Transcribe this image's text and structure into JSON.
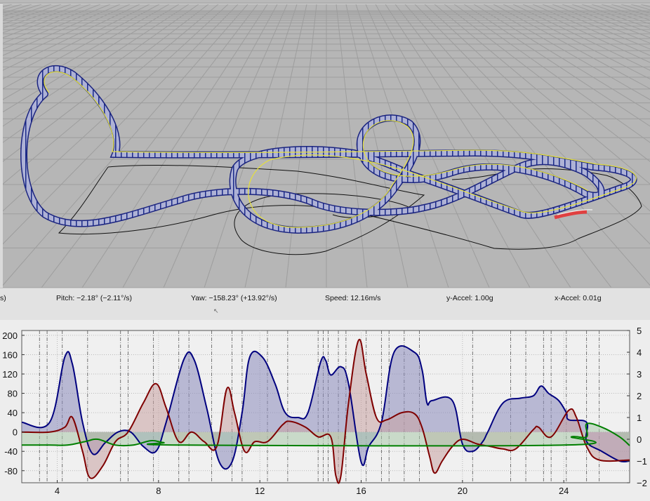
{
  "status": {
    "cut_label": "s)",
    "pitch": "Pitch: −2.18° (−2.11°/s)",
    "yaw": "Yaw: −158.23° (+13.92°/s)",
    "speed": "Speed: 12.16m/s",
    "y_accel": "y-Accel: 1.00g",
    "x_accel": "x-Accel: 0.01g"
  },
  "chart_data": {
    "type": "line",
    "x_ticks": [
      "4",
      "8",
      "12",
      "16",
      "20",
      "24"
    ],
    "x_tick_values": [
      4,
      8,
      12,
      16,
      20,
      24
    ],
    "xlim": [
      2.6,
      26.6
    ],
    "left_axis": {
      "ticks": [
        "200",
        "160",
        "120",
        "80",
        "40",
        "0",
        "-40",
        "-80"
      ],
      "tick_values": [
        200,
        160,
        120,
        80,
        40,
        0,
        -40,
        -80
      ],
      "ylim": [
        -105,
        210
      ]
    },
    "right_axis": {
      "ticks": [
        "5",
        "4",
        "3",
        "2",
        "1",
        "0",
        "−1",
        "−2"
      ],
      "tick_values": [
        5,
        4,
        3,
        2,
        1,
        0,
        -1,
        -2
      ],
      "ylim": [
        -2,
        5
      ]
    },
    "series": [
      {
        "color": "#00007f",
        "fill": "#8a8abc",
        "axis": "left",
        "points": [
          [
            2.6,
            20
          ],
          [
            3.7,
            20
          ],
          [
            4.3,
            155
          ],
          [
            4.6,
            140
          ],
          [
            5.0,
            20
          ],
          [
            5.4,
            -45
          ],
          [
            5.9,
            -22
          ],
          [
            6.4,
            0
          ],
          [
            6.9,
            0
          ],
          [
            7.4,
            -30
          ],
          [
            7.9,
            -40
          ],
          [
            8.3,
            20
          ],
          [
            9.0,
            150
          ],
          [
            9.4,
            150
          ],
          [
            9.9,
            50
          ],
          [
            10.4,
            -62
          ],
          [
            10.9,
            -62
          ],
          [
            11.3,
            40
          ],
          [
            11.6,
            155
          ],
          [
            12.1,
            155
          ],
          [
            12.6,
            100
          ],
          [
            13.0,
            40
          ],
          [
            13.5,
            30
          ],
          [
            13.9,
            40
          ],
          [
            14.4,
            145
          ],
          [
            14.6,
            148
          ],
          [
            14.8,
            118
          ],
          [
            15.2,
            135
          ],
          [
            15.5,
            100
          ],
          [
            16.0,
            -62
          ],
          [
            16.3,
            -30
          ],
          [
            16.8,
            20
          ],
          [
            17.3,
            165
          ],
          [
            18.1,
            165
          ],
          [
            18.4,
            130
          ],
          [
            18.6,
            60
          ],
          [
            18.8,
            65
          ],
          [
            19.6,
            65
          ],
          [
            20.0,
            -25
          ],
          [
            20.4,
            -40
          ],
          [
            20.8,
            -20
          ],
          [
            21.0,
            0
          ],
          [
            21.6,
            60
          ],
          [
            22.3,
            70
          ],
          [
            22.8,
            75
          ],
          [
            23.1,
            95
          ],
          [
            23.4,
            80
          ],
          [
            23.8,
            65
          ],
          [
            24.1,
            40
          ],
          [
            24.2,
            25
          ],
          [
            24.9,
            20
          ],
          [
            24.9,
            -20
          ],
          [
            25.5,
            -40
          ],
          [
            26.2,
            -60
          ],
          [
            26.6,
            -60
          ]
        ]
      },
      {
        "color": "#7f0000",
        "fill": "#c9a3a3",
        "axis": "left",
        "points": [
          [
            2.6,
            0
          ],
          [
            3.7,
            0
          ],
          [
            4.3,
            10
          ],
          [
            4.6,
            30
          ],
          [
            5.0,
            -40
          ],
          [
            5.3,
            -95
          ],
          [
            5.8,
            -70
          ],
          [
            6.3,
            -20
          ],
          [
            6.8,
            0
          ],
          [
            7.4,
            60
          ],
          [
            7.9,
            100
          ],
          [
            8.3,
            50
          ],
          [
            8.8,
            -20
          ],
          [
            9.3,
            0
          ],
          [
            9.8,
            -20
          ],
          [
            10.3,
            -30
          ],
          [
            10.7,
            90
          ],
          [
            11.0,
            40
          ],
          [
            11.4,
            -40
          ],
          [
            11.8,
            -20
          ],
          [
            12.3,
            -20
          ],
          [
            12.9,
            15
          ],
          [
            13.2,
            22
          ],
          [
            13.8,
            10
          ],
          [
            14.3,
            -10
          ],
          [
            14.8,
            -10
          ],
          [
            15.0,
            -90
          ],
          [
            15.2,
            -90
          ],
          [
            15.5,
            60
          ],
          [
            15.9,
            190
          ],
          [
            16.2,
            120
          ],
          [
            16.6,
            30
          ],
          [
            17.0,
            25
          ],
          [
            17.6,
            40
          ],
          [
            18.1,
            38
          ],
          [
            18.4,
            10
          ],
          [
            18.7,
            -50
          ],
          [
            18.9,
            -85
          ],
          [
            19.2,
            -60
          ],
          [
            19.6,
            -30
          ],
          [
            20.0,
            -15
          ],
          [
            20.6,
            -25
          ],
          [
            21.1,
            -30
          ],
          [
            21.6,
            -35
          ],
          [
            22.1,
            -35
          ],
          [
            22.8,
            5
          ],
          [
            23.0,
            10
          ],
          [
            23.5,
            -10
          ],
          [
            24.2,
            45
          ],
          [
            24.5,
            30
          ],
          [
            24.9,
            -30
          ],
          [
            25.4,
            -58
          ],
          [
            26.6,
            -58
          ]
        ]
      },
      {
        "color": "#007f00",
        "fill": "#a9c9a9",
        "axis": "left",
        "points": [
          [
            2.6,
            -27
          ],
          [
            3.7,
            -27
          ],
          [
            4.4,
            -27
          ],
          [
            5.1,
            -20
          ],
          [
            5.6,
            -15
          ],
          [
            6.3,
            -27
          ],
          [
            7.0,
            -27
          ],
          [
            7.7,
            -18
          ],
          [
            8.2,
            -22
          ],
          [
            9.0,
            -27
          ],
          [
            24.0,
            -27
          ],
          [
            24.3,
            -10
          ],
          [
            24.9,
            -10
          ],
          [
            24.9,
            17
          ],
          [
            25.5,
            10
          ],
          [
            26.2,
            -10
          ],
          [
            26.6,
            -28
          ]
        ]
      }
    ],
    "zero_line_left": 0,
    "vertical_markers": [
      3.3,
      3.6,
      4.2,
      5.2,
      6.5,
      6.8,
      7.8,
      8.8,
      9.2,
      10.1,
      10.9,
      11.3,
      12.3,
      13.1,
      14.3,
      14.5,
      14.7,
      15.1,
      15.4,
      16.2,
      16.8,
      17.1,
      17.7,
      18.3,
      20.4,
      21.9,
      22.5,
      23.2,
      23.5,
      24.1,
      24.9,
      25.4
    ]
  }
}
